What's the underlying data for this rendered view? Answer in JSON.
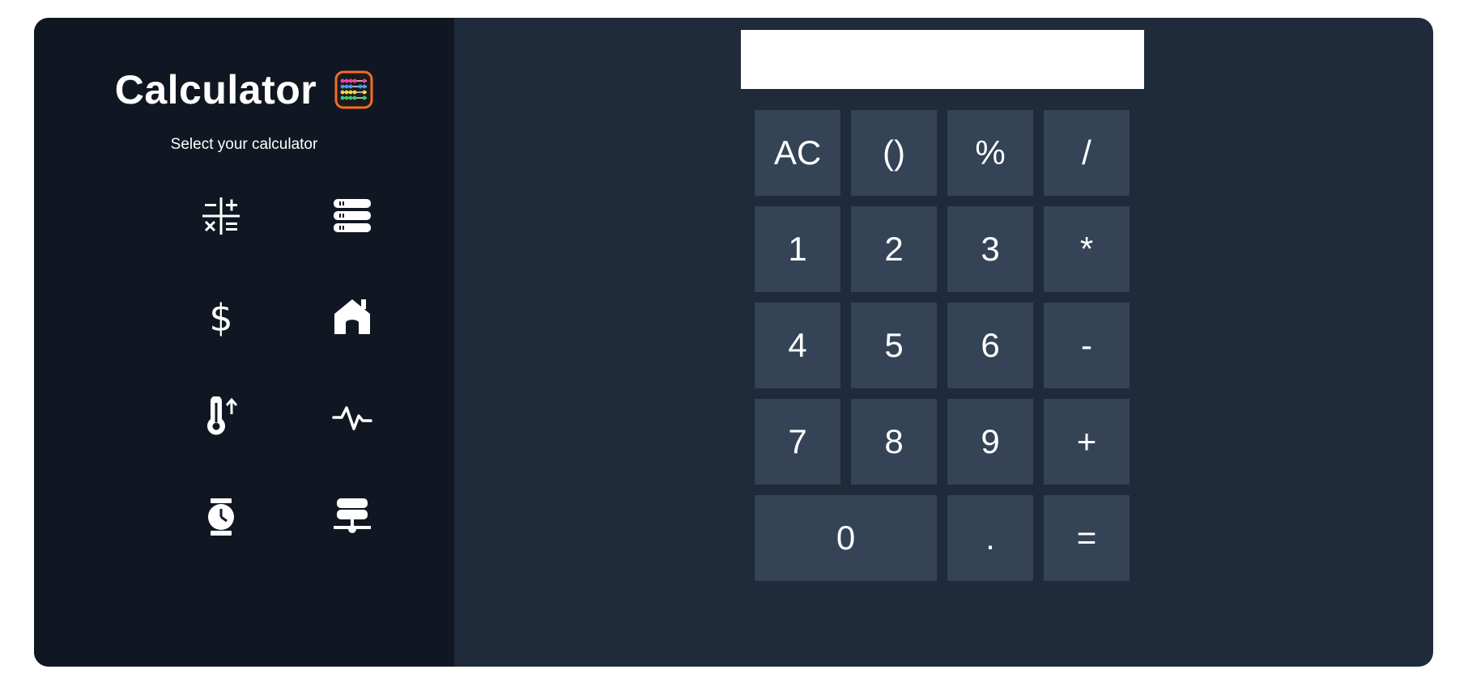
{
  "sidebar": {
    "title": "Calculator",
    "logo_icon": "abacus-icon",
    "subtitle": "Select your calculator",
    "calculators": [
      {
        "icon": "arithmetic-icon"
      },
      {
        "icon": "stack-icon"
      },
      {
        "icon": "dollar-icon"
      },
      {
        "icon": "home-icon"
      },
      {
        "icon": "thermometer-up-icon"
      },
      {
        "icon": "pulse-icon"
      },
      {
        "icon": "stopwatch-icon"
      },
      {
        "icon": "network-icon"
      }
    ]
  },
  "display": {
    "value": ""
  },
  "keypad": {
    "keys": [
      "AC",
      "()",
      "%",
      "/",
      "1",
      "2",
      "3",
      "*",
      "4",
      "5",
      "6",
      "-",
      "7",
      "8",
      "9",
      "+",
      "0",
      ".",
      "="
    ]
  },
  "colors": {
    "sidebar_bg": "#111722",
    "main_bg": "#1f2a3a",
    "key_bg": "#344356",
    "text": "#ffffff",
    "abacus_frame": "#f26b2a"
  }
}
